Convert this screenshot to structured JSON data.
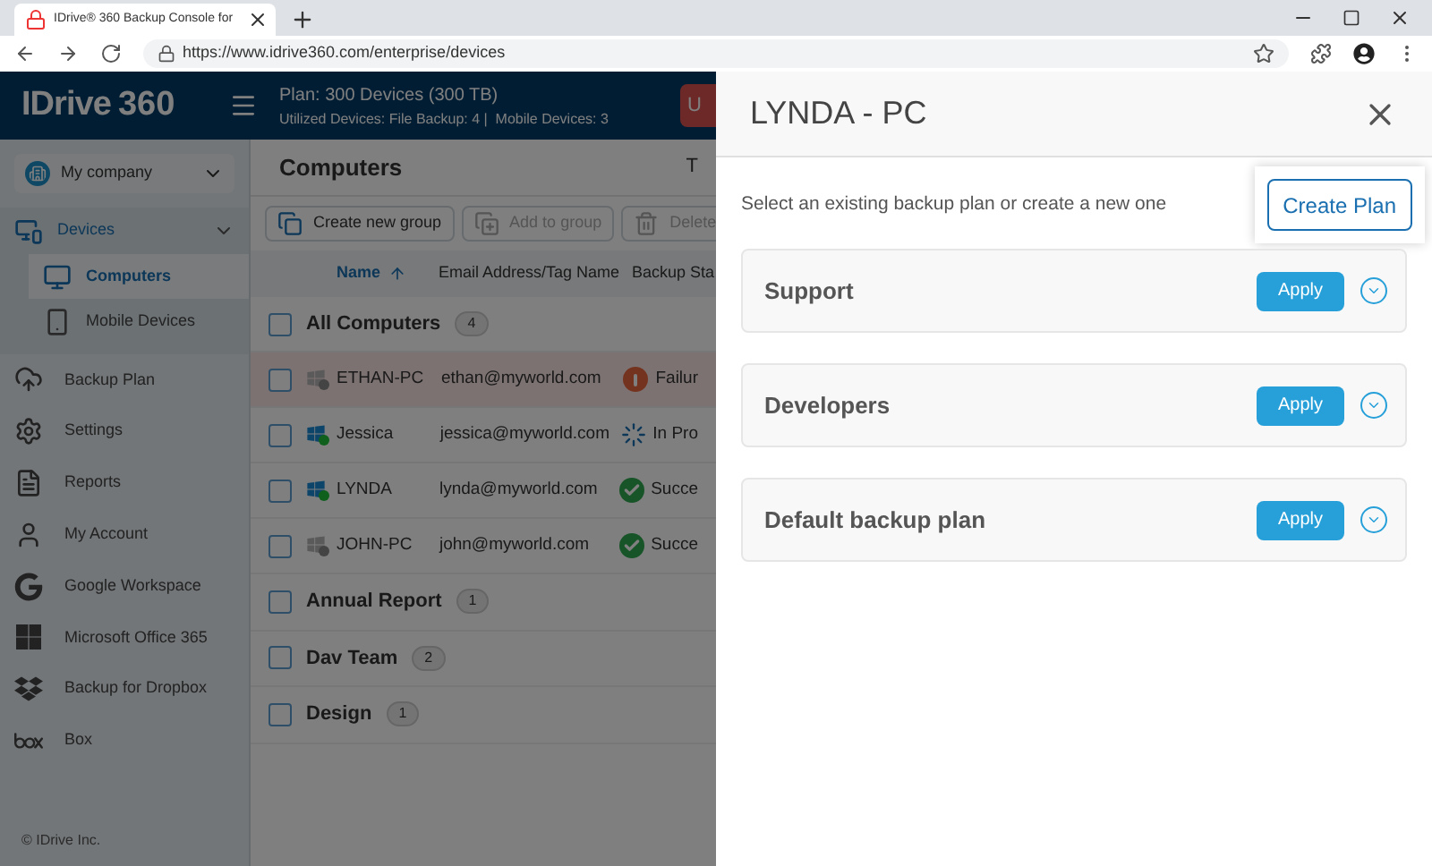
{
  "browser": {
    "tab_title": "IDrive® 360 Backup Console for",
    "url": "https://www.idrive360.com/enterprise/devices"
  },
  "header": {
    "logo": "IDrive",
    "logo_suffix": "360",
    "plan": "Plan: 300 Devices (300 TB)",
    "usage": "Utilized Devices: File Backup: 4 |  Mobile Devices: 3",
    "button_fragment": "U"
  },
  "sidebar": {
    "company": "My company",
    "items": [
      {
        "label": "Devices",
        "kind": "devices",
        "expanded": true,
        "children": [
          {
            "label": "Computers",
            "kind": "monitor",
            "selected": true
          },
          {
            "label": "Mobile Devices",
            "kind": "phone",
            "selected": false
          }
        ]
      },
      {
        "label": "Backup Plan",
        "kind": "cloud"
      },
      {
        "label": "Settings",
        "kind": "gear"
      },
      {
        "label": "Reports",
        "kind": "file"
      },
      {
        "label": "My Account",
        "kind": "user"
      },
      {
        "label": "Google Workspace",
        "kind": "google"
      },
      {
        "label": "Microsoft Office 365",
        "kind": "microsoft"
      },
      {
        "label": "Backup for Dropbox",
        "kind": "dropbox"
      },
      {
        "label": "Box",
        "kind": "box"
      }
    ],
    "footer": "© IDrive Inc."
  },
  "content": {
    "title": "Computers",
    "title_fragment": "T",
    "toolbar": [
      {
        "label": "Create new group",
        "kind": "group",
        "disabled": false
      },
      {
        "label": "Add to group",
        "kind": "add",
        "disabled": true
      },
      {
        "label": "Delete",
        "kind": "delete",
        "disabled": true
      }
    ],
    "table": {
      "columns": [
        "Name",
        "Email Address/Tag Name",
        "Backup Sta"
      ],
      "all_group": {
        "label": "All Computers",
        "count": "4",
        "checked": false
      },
      "rows": [
        {
          "name": "ETHAN-PC",
          "email": "ethan@myworld.com",
          "status": "Failur",
          "kind": "failure",
          "online": false,
          "checked": false,
          "highlighted": true
        },
        {
          "name": "Jessica",
          "email": "jessica@myworld.com",
          "status": "In Pro",
          "kind": "progress",
          "online": true,
          "checked": false,
          "highlighted": false
        },
        {
          "name": "LYNDA",
          "email": "lynda@myworld.com",
          "status": "Succe",
          "kind": "success",
          "online": true,
          "checked": false,
          "highlighted": false
        },
        {
          "name": "JOHN-PC",
          "email": "john@myworld.com",
          "status": "Succe",
          "kind": "success",
          "online": false,
          "checked": false,
          "highlighted": false
        }
      ],
      "groups": [
        {
          "label": "Annual Report",
          "count": "1",
          "checked": false
        },
        {
          "label": "Dav Team",
          "count": "2",
          "checked": false
        },
        {
          "label": "Design",
          "count": "1",
          "checked": false
        }
      ]
    }
  },
  "panel": {
    "title": "LYNDA - PC",
    "description": "Select an existing backup plan or create a new one",
    "create_button": "Create Plan",
    "plans": [
      {
        "name": "Support",
        "button": "Apply"
      },
      {
        "name": "Developers",
        "button": "Apply"
      },
      {
        "name": "Default backup plan",
        "button": "Apply"
      }
    ]
  }
}
